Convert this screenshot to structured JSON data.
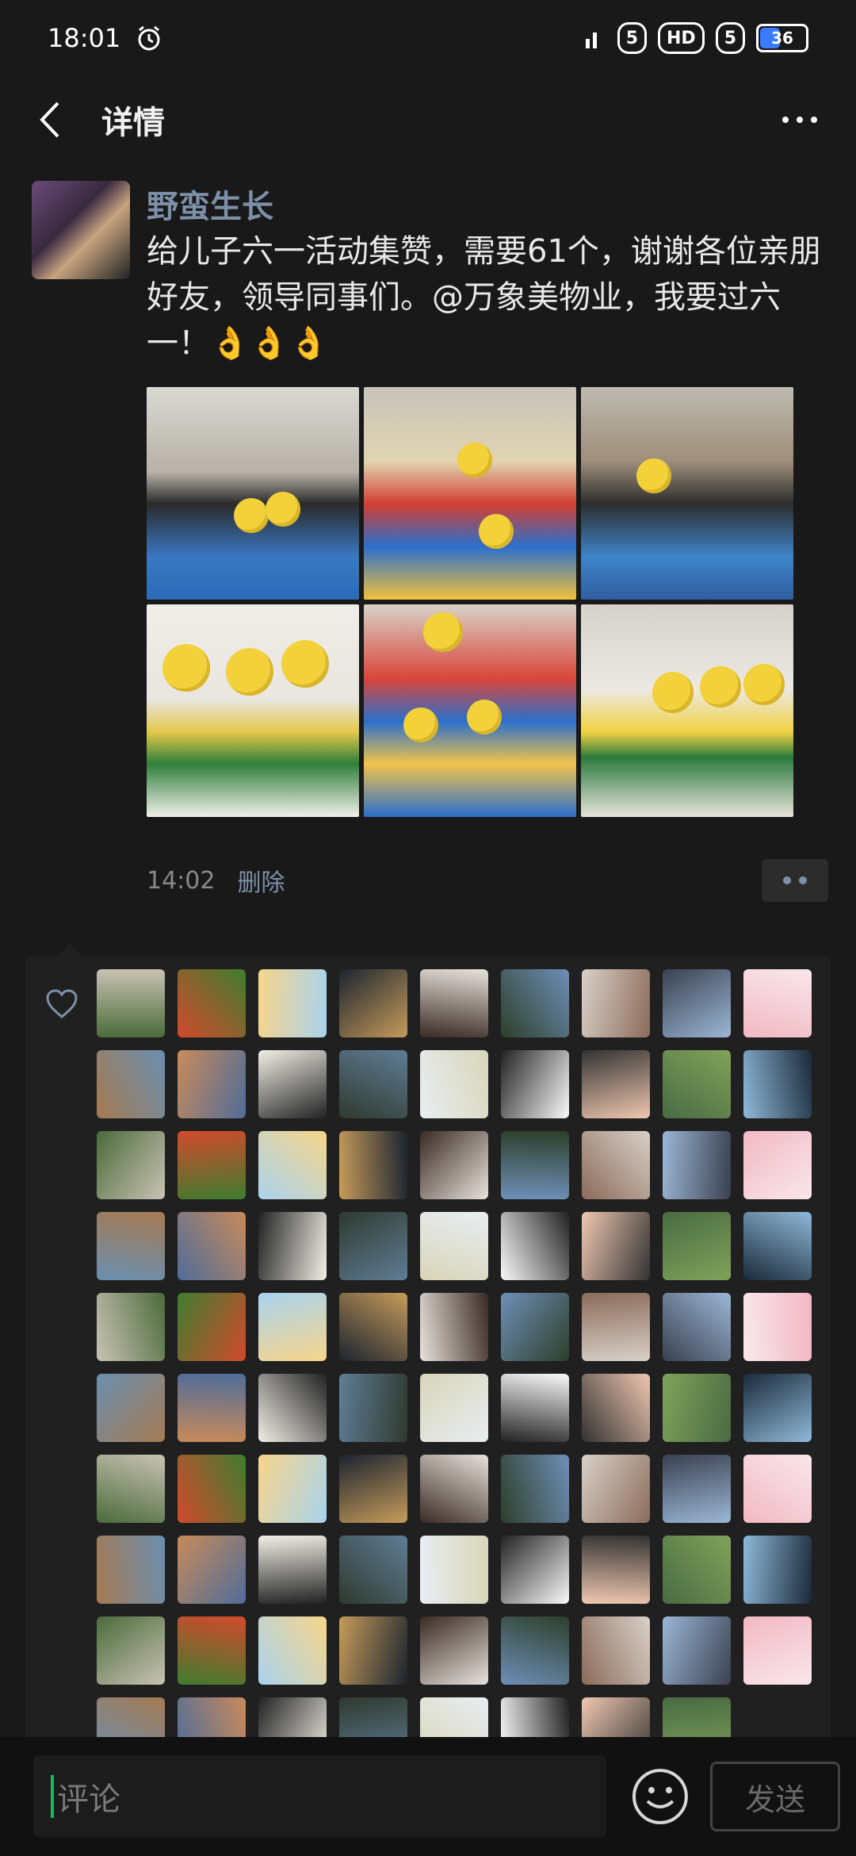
{
  "status_bar": {
    "time": "18:01",
    "icons": [
      "alarm-icon",
      "signal-icon",
      "5g-icon",
      "hd-icon",
      "5g-icon",
      "battery-icon"
    ],
    "sim1_badge": "5",
    "hd_badge": "HD",
    "sim2_badge": "5",
    "battery_level": "36",
    "battery_color": "#3b7bff"
  },
  "nav": {
    "title": "详情",
    "back_icon": "chevron-left-icon",
    "more_icon": "more-icon"
  },
  "post": {
    "author": "野蛮生长",
    "text": "给儿子六一活动集赞，需要61个，谢谢各位亲朋好友，领导同事们。@万象美物业，我要过六一！👌👌👌",
    "photo_count": 6,
    "time": "14:02",
    "delete_label": "删除",
    "name_color": "#7d90a9"
  },
  "likes": {
    "icon": "heart-icon",
    "avatar_count": 89
  },
  "comment_bar": {
    "placeholder": "评论",
    "send_label": "发送",
    "emoji_icon": "smiley-icon",
    "accent": "#07c160"
  }
}
